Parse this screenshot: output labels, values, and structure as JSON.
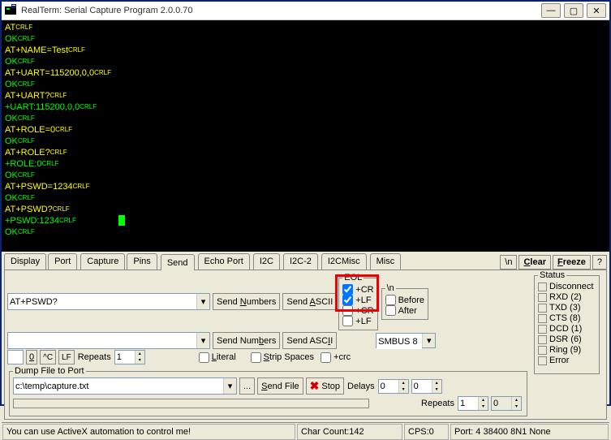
{
  "window": {
    "title": "RealTerm: Serial Capture Program 2.0.0.70"
  },
  "terminal": {
    "lines": [
      {
        "cls": "y",
        "text": "AT",
        "crlf": true
      },
      {
        "cls": "g",
        "text": "OK",
        "crlf": true
      },
      {
        "cls": "y",
        "text": "AT+NAME=Test",
        "crlf": true
      },
      {
        "cls": "g",
        "text": "OK",
        "crlf": true
      },
      {
        "cls": "y",
        "text": "AT+UART=115200,0,0",
        "crlf": true
      },
      {
        "cls": "g",
        "text": "OK",
        "crlf": true
      },
      {
        "cls": "y",
        "text": "AT+UART?",
        "crlf": true
      },
      {
        "cls": "g",
        "text": "+UART:115200,0,0",
        "crlf": true
      },
      {
        "cls": "g",
        "text": "OK",
        "crlf": true
      },
      {
        "cls": "y",
        "text": "AT+ROLE=0",
        "crlf": true
      },
      {
        "cls": "g",
        "text": "OK",
        "crlf": true
      },
      {
        "cls": "y",
        "text": "AT+ROLE?",
        "crlf": true
      },
      {
        "cls": "g",
        "text": "+ROLE:0",
        "crlf": true
      },
      {
        "cls": "g",
        "text": "OK",
        "crlf": true
      },
      {
        "cls": "y",
        "text": "AT+PSWD=1234",
        "crlf": true
      },
      {
        "cls": "g",
        "text": "OK",
        "crlf": true
      },
      {
        "cls": "y",
        "text": "AT+PSWD?",
        "crlf": true
      },
      {
        "cls": "g",
        "text": "+PSWD:1234",
        "crlf": true,
        "cursor": true
      },
      {
        "cls": "g",
        "text": "OK",
        "crlf": true
      }
    ]
  },
  "tabs": [
    "Display",
    "Port",
    "Capture",
    "Pins",
    "Send",
    "Echo Port",
    "I2C",
    "I2C-2",
    "I2CMisc",
    "Misc"
  ],
  "active_tab": 4,
  "toolbar_right": {
    "newline": "\\n",
    "clear": "Clear",
    "freeze": "Freeze",
    "help": "?"
  },
  "send": {
    "line1": "AT+PSWD?",
    "line2": "",
    "send_numbers": "Send Numbers",
    "send_ascii": "Send ASCII",
    "eol": {
      "legend": "EOL",
      "cr": "+CR",
      "lf": "+LF",
      "cr2": "+CR",
      "lf2": "+LF",
      "cr_checked": true,
      "lf_checked": true
    },
    "backslash_n": {
      "legend": "\\n",
      "before": "Before",
      "after": "After"
    },
    "zero": "0",
    "carC": "^C",
    "LF": "LF",
    "repeats": "Repeats",
    "repeats_val": "1",
    "literal": "Literal",
    "strip": "Strip Spaces",
    "plus_crc": "+crc",
    "smbus": "SMBUS 8"
  },
  "dump": {
    "legend": "Dump File to Port",
    "path": "c:\\temp\\capture.txt",
    "browse": "...",
    "send_file": "Send File",
    "stop": "Stop",
    "delays": "Delays",
    "d1": "0",
    "d2": "0",
    "repeats": "Repeats",
    "r1": "1",
    "r2": "0"
  },
  "status": {
    "legend": "Status",
    "items": [
      "Disconnect",
      "RXD (2)",
      "TXD (3)",
      "CTS (8)",
      "DCD (1)",
      "DSR (6)",
      "Ring (9)",
      "Error"
    ]
  },
  "statusbar": {
    "msg": "You can use ActiveX automation to control me!",
    "char": "Char Count:142",
    "cps": "CPS:0",
    "port": "Port: 4 38400 8N1 None"
  }
}
